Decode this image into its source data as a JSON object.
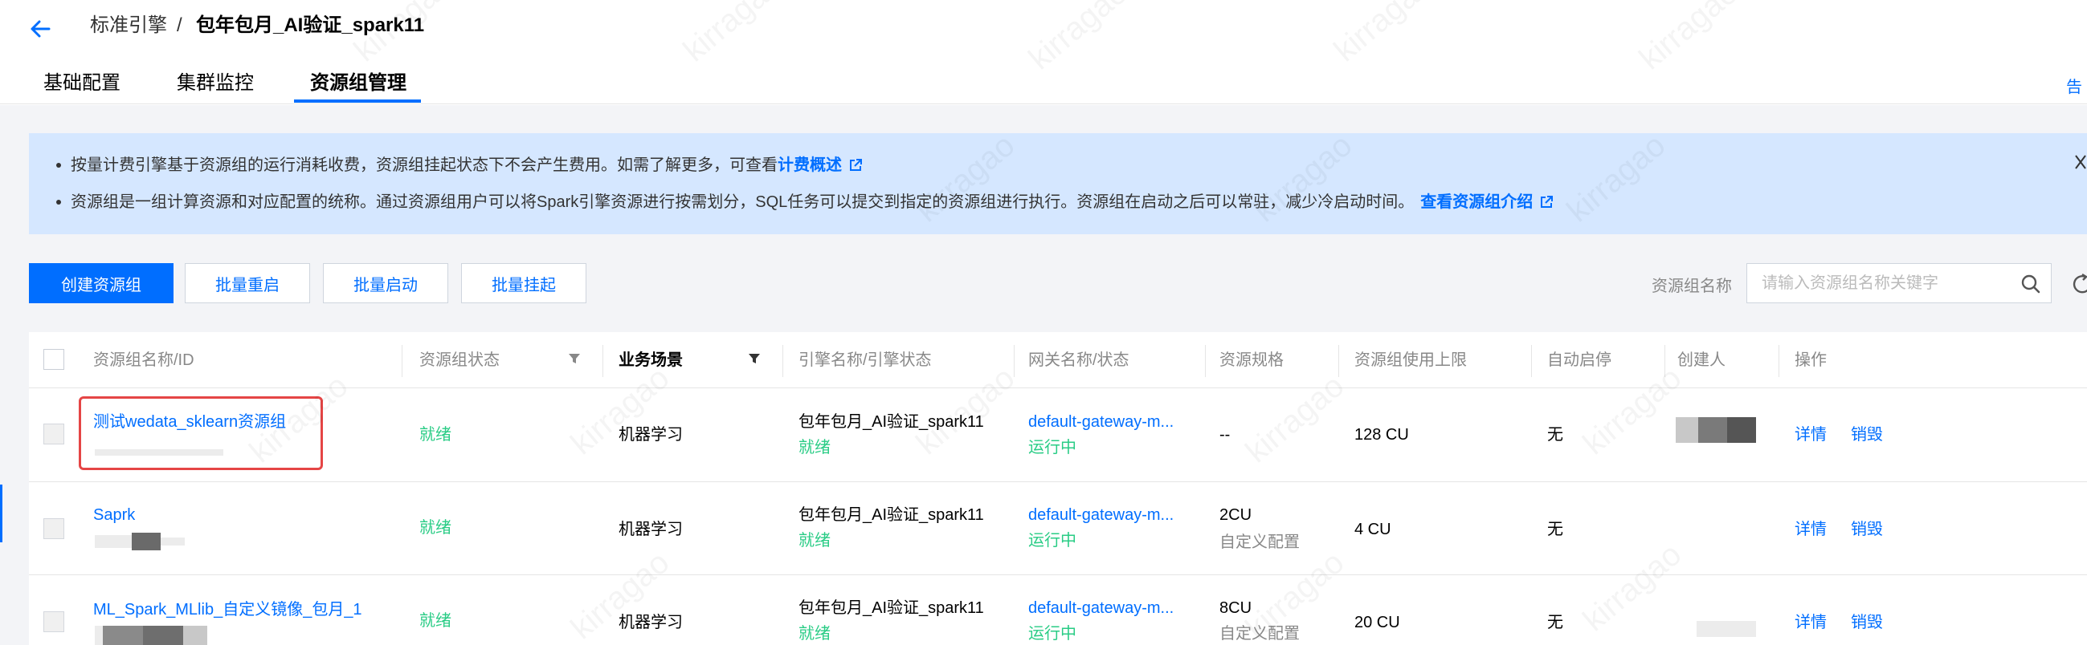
{
  "header": {
    "breadcrumb_parent": "标准引擎",
    "breadcrumb_sep": "/",
    "breadcrumb_current": "包年包月_AI验证_spark11",
    "right_edge_text": "告"
  },
  "tabs": [
    {
      "label": "基础配置",
      "active": false
    },
    {
      "label": "集群监控",
      "active": false
    },
    {
      "label": "资源组管理",
      "active": true
    }
  ],
  "notice": {
    "line1_text": "按量计费引擎基于资源组的运行消耗收费，资源组挂起状态下不会产生费用。如需了解更多，可查看",
    "line1_link": "计费概述",
    "line2_text": "资源组是一组计算资源和对应配置的统称。通过资源组用户可以将Spark引擎资源进行按需划分，SQL任务可以提交到指定的资源组进行执行。资源组在启动之后可以常驻，减少冷启动时间。",
    "line2_link": "查看资源组介绍"
  },
  "toolbar": {
    "create_label": "创建资源组",
    "batch_restart_label": "批量重启",
    "batch_start_label": "批量启动",
    "batch_suspend_label": "批量挂起",
    "search_label": "资源组名称",
    "search_placeholder": "请输入资源组名称关键字"
  },
  "table": {
    "columns": {
      "name": "资源组名称/ID",
      "status": "资源组状态",
      "scene": "业务场景",
      "engine": "引擎名称/引擎状态",
      "gateway": "网关名称/状态",
      "spec": "资源规格",
      "limit": "资源组使用上限",
      "auto_stop": "自动启停",
      "creator": "创建人",
      "actions": "操作"
    },
    "rows": [
      {
        "name": "测试wedata_sklearn资源组",
        "status": "就绪",
        "scene": "机器学习",
        "engine_name": "包年包月_AI验证_spark11",
        "engine_status": "就绪",
        "gateway_name": "default-gateway-m...",
        "gateway_status": "运行中",
        "spec": "--",
        "spec_sub": "",
        "limit": "128 CU",
        "auto_stop": "无",
        "detail": "详情",
        "destroy": "销毁"
      },
      {
        "name": "Saprk",
        "status": "就绪",
        "scene": "机器学习",
        "engine_name": "包年包月_AI验证_spark11",
        "engine_status": "就绪",
        "gateway_name": "default-gateway-m...",
        "gateway_status": "运行中",
        "spec": "2CU",
        "spec_sub": "自定义配置",
        "limit": "4 CU",
        "auto_stop": "无",
        "detail": "详情",
        "destroy": "销毁"
      },
      {
        "name": "ML_Spark_MLlib_自定义镜像_包月_1",
        "status": "就绪",
        "scene": "机器学习",
        "engine_name": "包年包月_AI验证_spark11",
        "engine_status": "就绪",
        "gateway_name": "default-gateway-m...",
        "gateway_status": "运行中",
        "spec": "8CU",
        "spec_sub": "自定义配置",
        "limit": "20 CU",
        "auto_stop": "无",
        "detail": "详情",
        "destroy": "销毁"
      }
    ]
  },
  "watermark": "kirragao",
  "colors": {
    "primary": "#006eff",
    "success": "#29cc85",
    "notice_bg": "#d5e7ff",
    "page_bg": "#f3f4f7",
    "highlight": "#e54545"
  }
}
